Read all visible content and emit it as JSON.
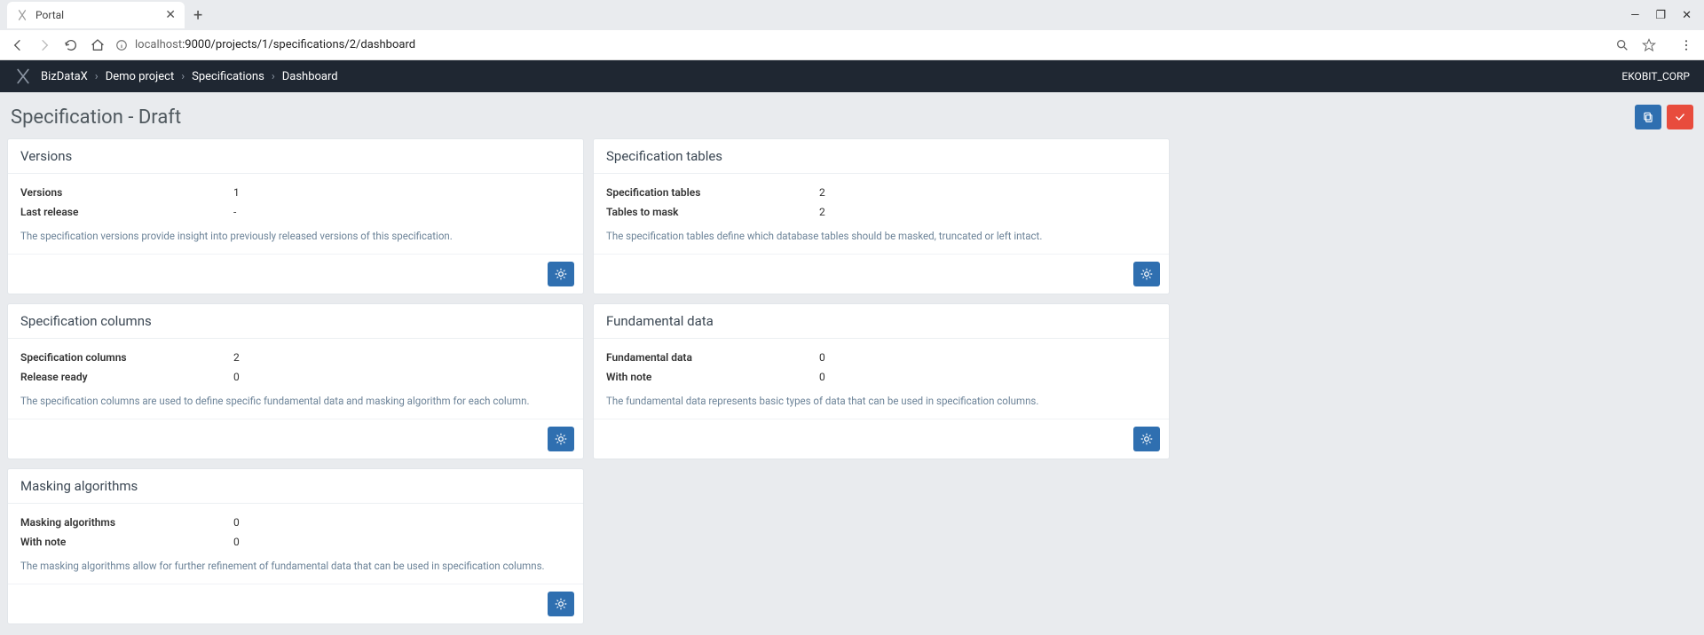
{
  "browser": {
    "tab_title": "Portal",
    "url_host": "localhost",
    "url_path": ":9000/projects/1/specifications/2/dashboard"
  },
  "navbar": {
    "brand": "BizDataX",
    "crumbs": [
      "Demo project",
      "Specifications",
      "Dashboard"
    ],
    "user": "EKOBIT_CORP"
  },
  "page": {
    "title": "Specification - Draft"
  },
  "cards": [
    {
      "title": "Versions",
      "rows": [
        {
          "label": "Versions",
          "value": "1"
        },
        {
          "label": "Last release",
          "value": "-"
        }
      ],
      "desc": "The specification versions provide insight into previously released versions of this specification."
    },
    {
      "title": "Specification tables",
      "rows": [
        {
          "label": "Specification tables",
          "value": "2"
        },
        {
          "label": "Tables to mask",
          "value": "2"
        }
      ],
      "desc": "The specification tables define which database tables should be masked, truncated or left intact."
    },
    {
      "title": "Specification columns",
      "rows": [
        {
          "label": "Specification columns",
          "value": "2"
        },
        {
          "label": "Release ready",
          "value": "0"
        }
      ],
      "desc": "The specification columns are used to define specific fundamental data and masking algorithm for each column."
    },
    {
      "title": "Fundamental data",
      "rows": [
        {
          "label": "Fundamental data",
          "value": "0"
        },
        {
          "label": "With note",
          "value": "0"
        }
      ],
      "desc": "The fundamental data represents basic types of data that can be used in specification columns."
    },
    {
      "title": "Masking algorithms",
      "rows": [
        {
          "label": "Masking algorithms",
          "value": "0"
        },
        {
          "label": "With note",
          "value": "0"
        }
      ],
      "desc": "The masking algorithms allow for further refinement of fundamental data that can be used in specification columns."
    }
  ]
}
